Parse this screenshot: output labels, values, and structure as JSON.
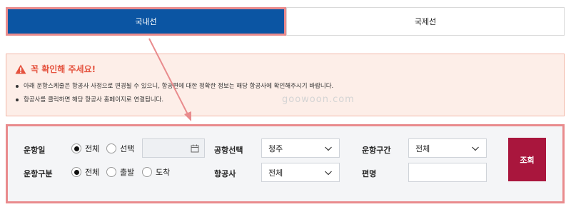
{
  "tabs": {
    "domestic": "국내선",
    "international": "국제선"
  },
  "notice": {
    "title": "꼭 확인해 주세요!",
    "items": [
      "아래 운항스케줄은 항공사 사정으로 변경될 수 있으니, 항공편에 대한 정확한 정보는 해당 항공사에 확인해주시기 바랍니다.",
      "항공사를 클릭하면 해당 항공사 홈페이지로 연결됩니다."
    ]
  },
  "watermark": "goowoon.com",
  "search": {
    "flight_date_label": "운항일",
    "date_options": [
      "전체",
      "선택"
    ],
    "date_selected": "전체",
    "date_value": "",
    "airport_label": "공항선택",
    "airport_value": "청주",
    "route_label": "운항구간",
    "route_value": "전체",
    "flight_type_label": "운항구분",
    "type_options": [
      "전체",
      "출발",
      "도착"
    ],
    "type_selected": "전체",
    "airline_label": "항공사",
    "airline_value": "전체",
    "flight_no_label": "편명",
    "flight_no_value": "",
    "submit_label": "조회"
  },
  "colors": {
    "tab_active": "#0b55a3",
    "highlight_border": "#e98b8d",
    "notice_bg": "#fdeee8",
    "notice_title": "#e5533f",
    "submit_button": "#a9163d"
  },
  "icons": {
    "notice": "warning-triangle-icon",
    "select": "chevron-down-icon",
    "date": "calendar-icon"
  }
}
